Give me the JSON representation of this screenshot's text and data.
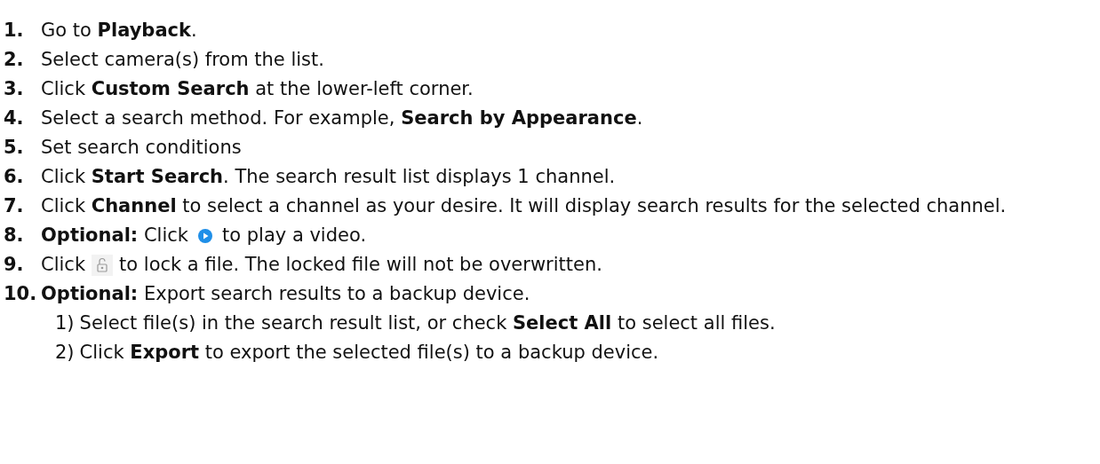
{
  "steps": [
    {
      "number": "1.",
      "text": "Go to **Playback**."
    },
    {
      "number": "2.",
      "text": "Select camera(s) from the list."
    },
    {
      "number": "3.",
      "text": "Click **Custom Search** at the lower-left corner."
    },
    {
      "number": "4.",
      "text": "Select a search method. For example, **Search by Appearance**."
    },
    {
      "number": "5.",
      "text": "Set search conditions"
    },
    {
      "number": "6.",
      "text": "Click **Start Search**. The search result list displays 1 channel."
    },
    {
      "number": "7.",
      "text": "Click **Channel** to select a channel as your desire. It will display search results for the selected channel."
    },
    {
      "number": "8.",
      "text": "**Optional:** Click",
      "kind": "play",
      "text_after": "to play a video."
    },
    {
      "number": "9.",
      "text": "Click",
      "kind": "lock",
      "text_after": "to lock a file. The locked file will not be overwritten."
    },
    {
      "number": "10.",
      "text": "**Optional:** Export search results to a backup device.",
      "substeps": [
        {
          "number": "1)",
          "text": "Select file(s) in the search result list, or check **Select All** to select all files."
        },
        {
          "number": "2)",
          "text": "Click **Export** to export the selected file(s) to a backup device."
        }
      ]
    }
  ]
}
